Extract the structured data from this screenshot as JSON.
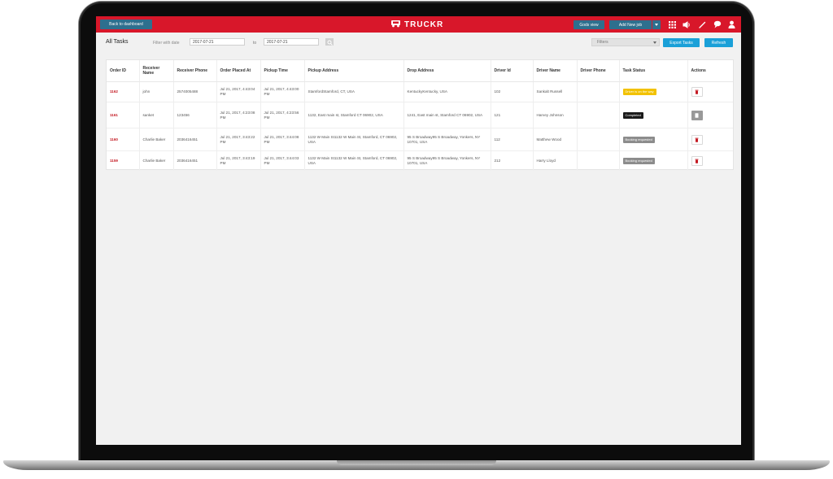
{
  "header": {
    "back_label": "Back to dashboard",
    "brand": "TRUCKR",
    "gods_view_label": "Gods view",
    "add_job_label": "Add New job",
    "colors": {
      "bar": "#d8172a",
      "button": "#2e6f8e"
    },
    "icons": [
      "grid-icon",
      "speaker-icon",
      "wand-icon",
      "chat-icon",
      "user-icon"
    ]
  },
  "filters": {
    "title": "All Tasks",
    "filter_label": "Filter with date",
    "from_date": "2017-07-21",
    "to_label": "to",
    "to_date": "2017-07-21",
    "select_label": "Filters",
    "export_label": "Export Tasks",
    "refresh_label": "Refresh",
    "accent": "#1aa0d8"
  },
  "table": {
    "columns": [
      "Order ID",
      "Receiver Name",
      "Receiver Phone",
      "Order Placed At",
      "Pickup Time",
      "Pickup Address",
      "Drop Address",
      "Driver Id",
      "Driver Name",
      "Driver Phone",
      "Task Status",
      "Actions"
    ],
    "rows": [
      {
        "order_id": "1162",
        "receiver_name": "john",
        "receiver_phone": "2574005488",
        "placed_at": "Jul 21, 2017, 4:43:04 PM",
        "pickup_time": "Jul 21, 2017, 4:43:00 PM",
        "pickup_address": "StamfordStamford, CT, USA",
        "drop_address": "KentuckyKentucky, USA",
        "driver_id": "102",
        "driver_name": "Sankalt Russell",
        "driver_phone": "",
        "status": "Driver is on the way",
        "status_color": "#f2c200",
        "action_icon": "trash-icon"
      },
      {
        "order_id": "1161",
        "receiver_name": "sanket",
        "receiver_phone": "123456",
        "placed_at": "Jul 21, 2017, 4:23:08 PM",
        "pickup_time": "Jul 21, 2017, 4:23:56 PM",
        "pickup_address": "1132, East main st, Stamford CT 06902, USA",
        "drop_address": "1241, East main st, Stamford CT 06902, USA",
        "driver_id": "121",
        "driver_name": "Harvey Johnson",
        "driver_phone": "",
        "status": "Completed",
        "status_color": "#1a1a1a",
        "action_icon": "document-icon"
      },
      {
        "order_id": "1160",
        "receiver_name": "Charlie Baker",
        "receiver_phone": "2036416451",
        "placed_at": "Jul 21, 2017, 3:43:22 PM",
        "pickup_time": "Jul 21, 2017, 3:44:08 PM",
        "pickup_address": "1132 W Main St1132 W Main St, Stamford, CT 06902, USA",
        "drop_address": "95 S Broadway95 S Broadway, Yonkers, NY 10701, USA",
        "driver_id": "112",
        "driver_name": "Matthew Wood",
        "driver_phone": "",
        "status": "Booking requested",
        "status_color": "#8c8c8c",
        "action_icon": "trash-icon"
      },
      {
        "order_id": "1159",
        "receiver_name": "Charlie Baker",
        "receiver_phone": "2036416451",
        "placed_at": "Jul 21, 2017, 3:43:19 PM",
        "pickup_time": "Jul 21, 2017, 3:44:03 PM",
        "pickup_address": "1132 W Main St1132 W Main St, Stamford, CT 06902, USA",
        "drop_address": "95 S Broadway95 S Broadway, Yonkers, NY 10701, USA",
        "driver_id": "212",
        "driver_name": "Harry Lloyd",
        "driver_phone": "",
        "status": "Booking requested",
        "status_color": "#8c8c8c",
        "action_icon": "trash-icon"
      }
    ]
  }
}
